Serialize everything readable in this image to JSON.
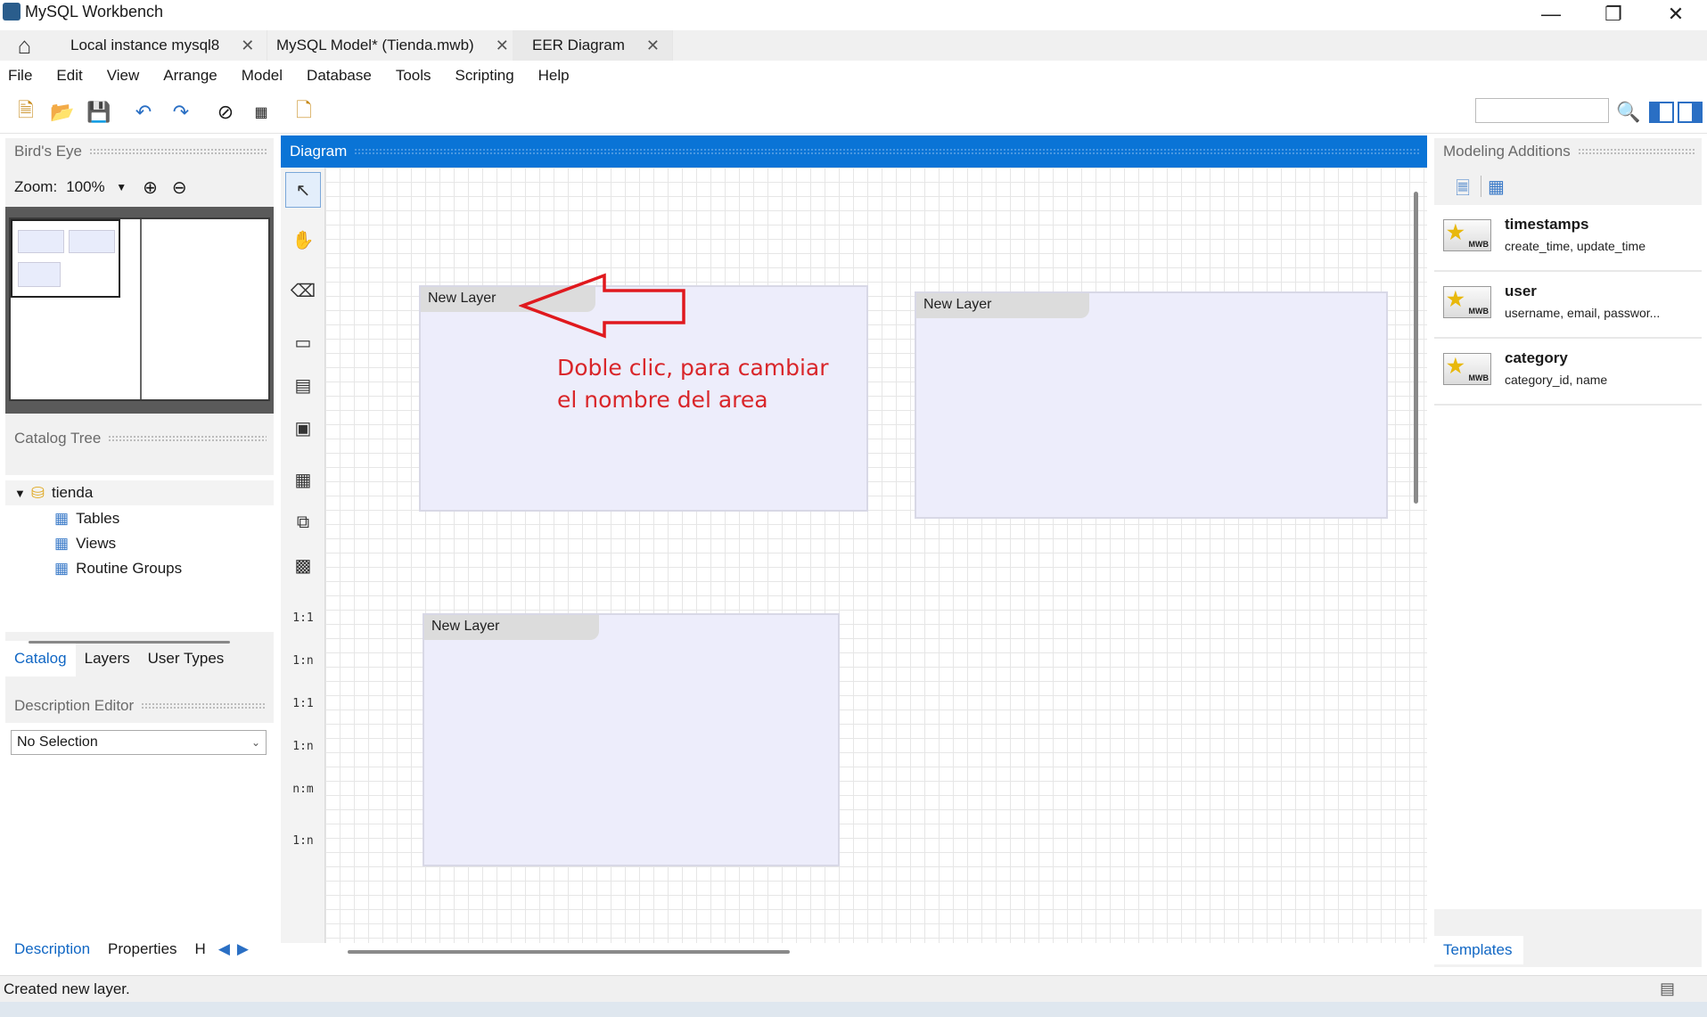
{
  "window": {
    "title": "MySQL Workbench"
  },
  "tabs": [
    {
      "label": "Local instance mysql8"
    },
    {
      "label": "MySQL Model* (Tienda.mwb)"
    },
    {
      "label": "EER Diagram"
    }
  ],
  "menu": [
    "File",
    "Edit",
    "View",
    "Arrange",
    "Model",
    "Database",
    "Tools",
    "Scripting",
    "Help"
  ],
  "left": {
    "birds_eye": {
      "title": "Bird's Eye",
      "zoom_label": "Zoom:",
      "zoom_value": "100%"
    },
    "catalog_tree": {
      "title": "Catalog Tree",
      "schema": "tienda",
      "items": [
        "Tables",
        "Views",
        "Routine Groups"
      ]
    },
    "tabs": [
      "Catalog",
      "Layers",
      "User Types"
    ],
    "description_editor": {
      "title": "Description Editor",
      "selection": "No Selection"
    },
    "bottom_tabs": [
      "Description",
      "Properties",
      "H"
    ]
  },
  "diagram": {
    "title": "Diagram",
    "layers": [
      "New Layer",
      "New Layer",
      "New Layer"
    ],
    "annotation": [
      "Doble clic, para cambiar",
      "el nombre del area"
    ],
    "tools": [
      "1:1",
      "1:n",
      "1:1",
      "1:n",
      "n:m",
      "1:n"
    ]
  },
  "right": {
    "title": "Modeling Additions",
    "snippets": [
      {
        "name": "timestamps",
        "desc": "create_time, update_time",
        "badge": "MWB"
      },
      {
        "name": "user",
        "desc": "username, email, passwor...",
        "badge": "MWB"
      },
      {
        "name": "category",
        "desc": "category_id, name",
        "badge": "MWB"
      }
    ],
    "bottom_tab": "Templates"
  },
  "status": {
    "text": "Created new layer."
  },
  "colors": {
    "accent": "#0a74d6",
    "annotation": "#d9262a",
    "layer_bg": "#ededfb"
  }
}
